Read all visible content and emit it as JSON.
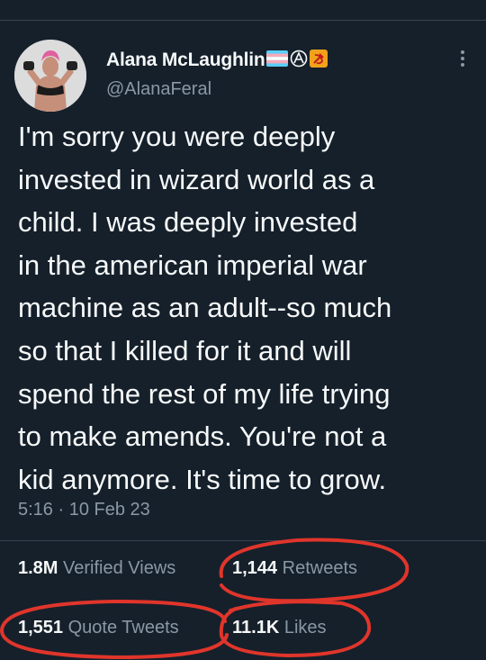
{
  "user": {
    "display_name": "Alana McLaughlin",
    "handle": "@AlanaFeral",
    "name_emojis": [
      "transgender-flag",
      "circled-a",
      "hammer-sickle"
    ]
  },
  "tweet": {
    "text": "I'm sorry you were deeply\ninvested in wizard world as a\nchild. I was deeply invested\nin the american imperial war\nmachine as an adult--so much\nso that I killed for it and will\nspend the rest of my life trying\nto make amends. You're not a\nkid anymore. It's time to grow.",
    "timestamp": "5:16 · 10 Feb 23"
  },
  "stats": {
    "views_count": "1.8M",
    "views_label": "Verified Views",
    "retweets_count": "1,144",
    "retweets_label": "Retweets",
    "quotes_count": "1,551",
    "quotes_label": "Quote Tweets",
    "likes_count": "11.1K",
    "likes_label": "Likes"
  },
  "colors": {
    "background": "#15202b",
    "text": "#f7f9f9",
    "secondary_text": "#8b98a5",
    "divider": "#38444d",
    "annotation": "#e0352b"
  }
}
